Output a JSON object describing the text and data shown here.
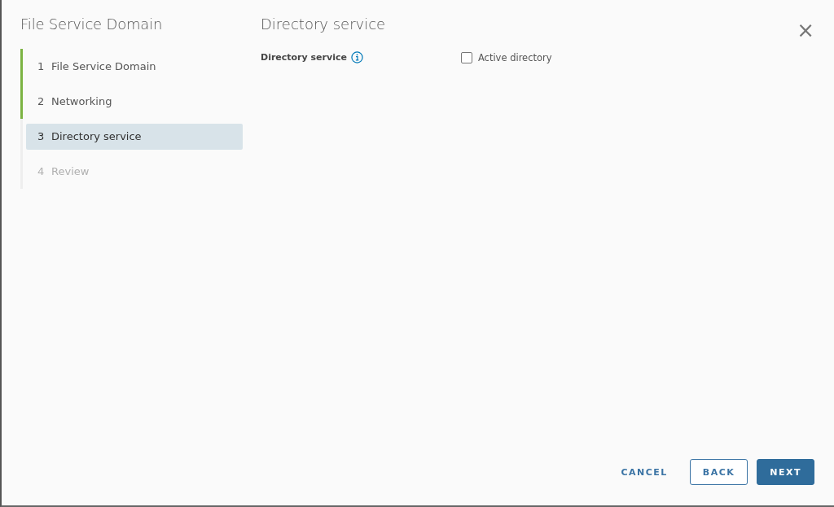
{
  "dialog": {
    "title": "File Service Domain",
    "close_label": "×"
  },
  "steps": [
    {
      "number": "1",
      "label": "File Service Domain",
      "completed": true,
      "selected": false,
      "disabled": false
    },
    {
      "number": "2",
      "label": "Networking",
      "completed": true,
      "selected": false,
      "disabled": false
    },
    {
      "number": "3",
      "label": "Directory service",
      "completed": false,
      "selected": true,
      "disabled": false
    },
    {
      "number": "4",
      "label": "Review",
      "completed": false,
      "selected": false,
      "disabled": true
    }
  ],
  "page": {
    "title": "Directory service",
    "field_label": "Directory service",
    "option": {
      "label": "Active directory",
      "checked": false
    }
  },
  "buttons": [
    {
      "label": "CANCEL",
      "kind": "flat"
    },
    {
      "label": "BACK",
      "kind": "outline"
    },
    {
      "label": "NEXT",
      "kind": "primary"
    }
  ]
}
